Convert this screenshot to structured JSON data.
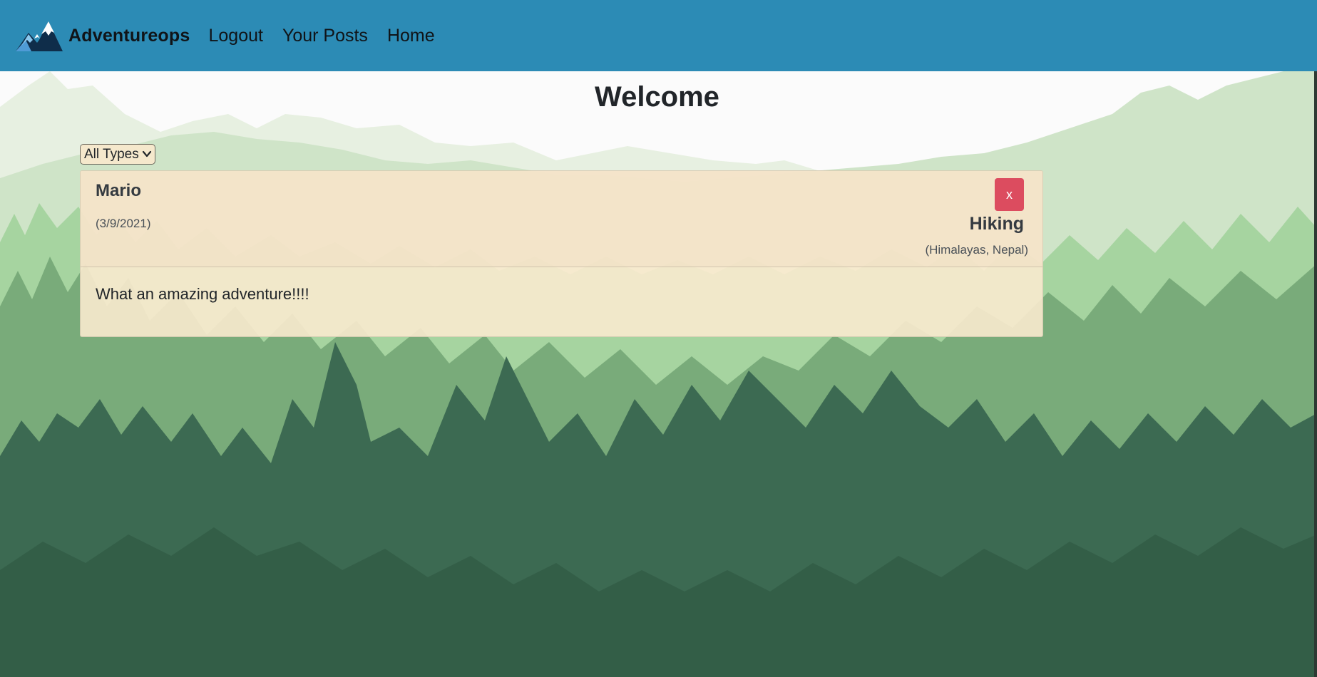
{
  "navbar": {
    "brand": "Adventureops",
    "links": [
      {
        "label": "Logout"
      },
      {
        "label": "Your Posts"
      },
      {
        "label": "Home"
      }
    ],
    "color": "#2c8bb5"
  },
  "main": {
    "title": "Welcome",
    "filter": {
      "selected": "All Types",
      "options": [
        "All Types"
      ]
    },
    "posts": [
      {
        "author": "Mario",
        "date": "(3/9/2021)",
        "delete_label": "x",
        "type": "Hiking",
        "location": "(Himalayas, Nepal)",
        "body": "What an amazing adventure!!!!"
      }
    ]
  },
  "icons": {
    "brand_logo": "mountain-icon",
    "select_arrow": "chevron-down-icon"
  },
  "colors": {
    "delete_button": "#dc4c5f",
    "card_background": "#faeace"
  }
}
